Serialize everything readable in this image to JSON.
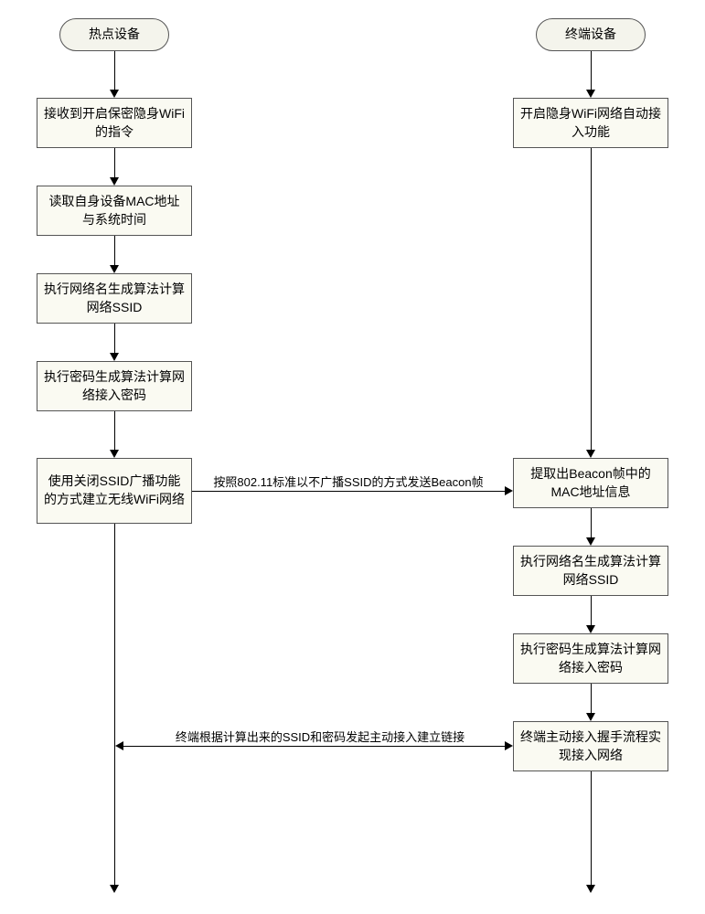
{
  "left": {
    "terminator": "热点设备",
    "steps": [
      "接收到开启保密隐身WiFi的指令",
      "读取自身设备MAC地址与系统时间",
      "执行网络名生成算法计算网络SSID",
      "执行密码生成算法计算网络接入密码",
      "使用关闭SSID广播功能的方式建立无线WiFi网络"
    ]
  },
  "right": {
    "terminator": "终端设备",
    "steps": [
      "开启隐身WiFi网络自动接入功能",
      "提取出Beacon帧中的MAC地址信息",
      "执行网络名生成算法计算网络SSID",
      "执行密码生成算法计算网络接入密码",
      "终端主动接入握手流程实现接入网络"
    ]
  },
  "h_arrows": {
    "beacon": "按照802.11标准以不广播SSID的方式发送Beacon帧",
    "handshake": "终端根据计算出来的SSID和密码发起主动接入建立链接"
  }
}
